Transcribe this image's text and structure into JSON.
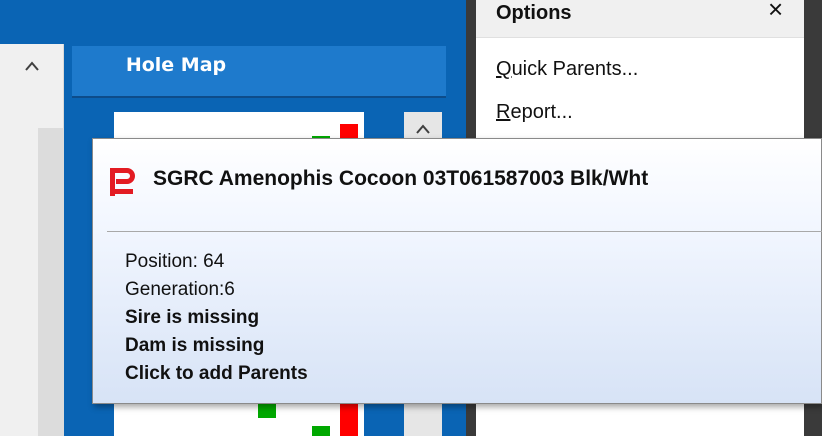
{
  "holemap": {
    "title": "Hole Map",
    "marks_color_red": "#ff0000",
    "marks_color_green": "#00a800"
  },
  "options_menu": {
    "title": "Options",
    "close_glyph": "×",
    "items": [
      {
        "label": "Quick Parents...",
        "mnemonic": "Q",
        "rest": "uick Parents..."
      },
      {
        "label": "Report...",
        "mnemonic": "R",
        "rest": "eport..."
      }
    ]
  },
  "tooltip": {
    "title": "SGRC Amenophis Cocoon 03T061587003 Blk/Wht",
    "position": "Position: 64",
    "generation": "Generation:6",
    "sire": "Sire is missing",
    "dam": "Dam is missing",
    "action": "Click to add Parents",
    "logo_color": "#e31b23"
  },
  "icons": {
    "scroll_up": "▲"
  }
}
